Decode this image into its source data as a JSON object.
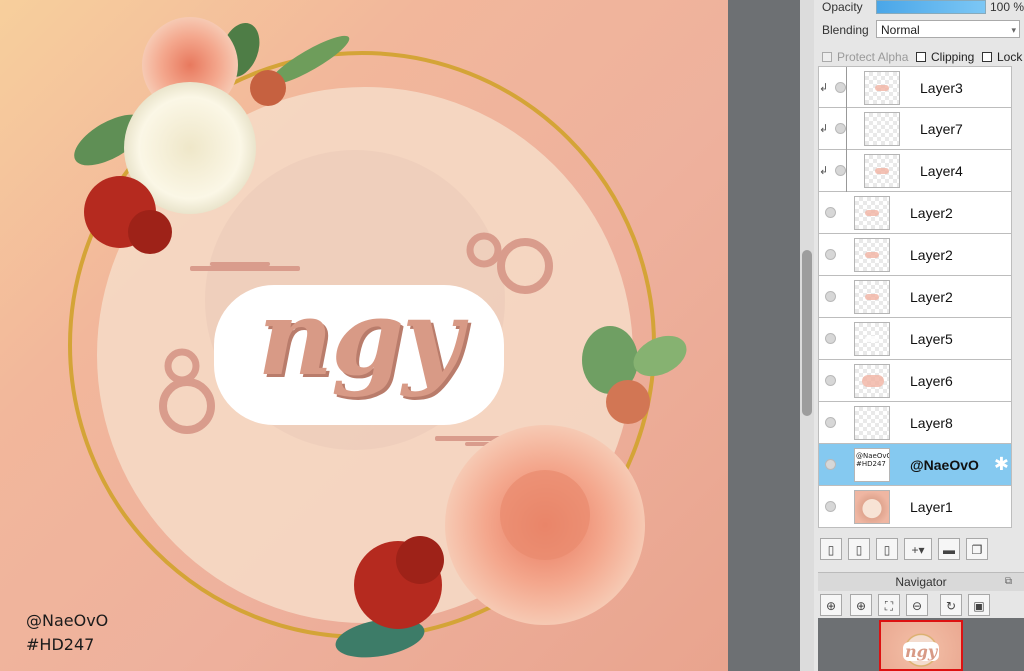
{
  "canvas": {
    "logo_text": "ngy",
    "credit_name": "@NaeOvO",
    "credit_tag": "#HD247",
    "colors": {
      "ring": "#d4a437",
      "circle_fill": "#f6dcc8",
      "text_pink": "#d89a86",
      "rose": "#f1a387",
      "red_flower": "#b52a1f"
    }
  },
  "properties": {
    "opacity_label": "Opacity",
    "opacity_value": "100 %",
    "blending_label": "Blending",
    "blending_value": "Normal",
    "protect_alpha": "Protect Alpha",
    "clipping": "Clipping",
    "lock": "Lock"
  },
  "layers": [
    {
      "name": "Layer3"
    },
    {
      "name": "Layer7"
    },
    {
      "name": "Layer4"
    },
    {
      "name": "Layer2"
    },
    {
      "name": "Layer2"
    },
    {
      "name": "Layer2"
    },
    {
      "name": "Layer5"
    },
    {
      "name": "Layer6"
    },
    {
      "name": "Layer8"
    },
    {
      "name": "@NaeOvO",
      "thumb_text_1": "@NaeOvO",
      "thumb_text_2": "#HD247"
    },
    {
      "name": "Layer1"
    }
  ],
  "toolbar_icons": [
    "new-layer-icon",
    "new-8bit-layer-icon",
    "new-1bit-layer-icon",
    "new-layer-menu-icon",
    "new-folder-icon",
    "copy-layer-icon"
  ],
  "navigator": {
    "title": "Navigator",
    "preview_text": "ngy",
    "icons": [
      "zoom-fit-icon",
      "zoom-in-icon",
      "zoom-fit-window-icon",
      "zoom-out-icon",
      "rotate-reset-icon",
      "full-view-icon"
    ]
  },
  "selection_color": "#85c9f0"
}
